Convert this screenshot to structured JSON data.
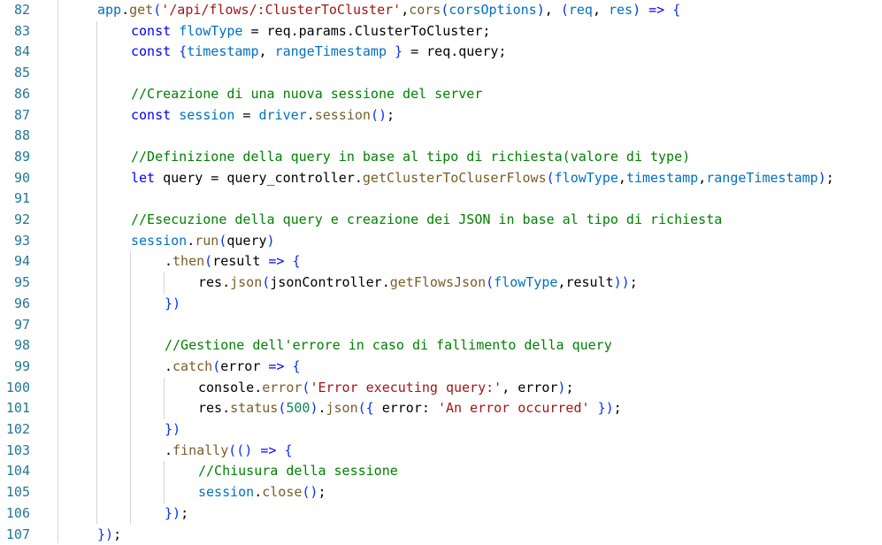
{
  "editor": {
    "colors": {
      "keyword": "#0000ff",
      "variable": "#0070c1",
      "function": "#795e26",
      "string": "#a31515",
      "comment": "#008000",
      "number": "#098658",
      "bracket": "#0431fa",
      "plain": "#000000",
      "line_number": "#237893"
    },
    "lines": [
      {
        "number": "82",
        "indent": 1,
        "tokens": [
          {
            "t": "app",
            "c": "var"
          },
          {
            "t": ".",
            "c": "plain"
          },
          {
            "t": "get",
            "c": "fn"
          },
          {
            "t": "(",
            "c": "brk"
          },
          {
            "t": "'/api/flows/:ClusterToCluster'",
            "c": "str"
          },
          {
            "t": ",",
            "c": "plain"
          },
          {
            "t": "cors",
            "c": "fn"
          },
          {
            "t": "(",
            "c": "brk"
          },
          {
            "t": "corsOptions",
            "c": "var"
          },
          {
            "t": ")",
            "c": "brk"
          },
          {
            "t": ", ",
            "c": "plain"
          },
          {
            "t": "(",
            "c": "brk"
          },
          {
            "t": "req",
            "c": "var"
          },
          {
            "t": ", ",
            "c": "plain"
          },
          {
            "t": "res",
            "c": "var"
          },
          {
            "t": ")",
            "c": "brk"
          },
          {
            "t": " ",
            "c": "plain"
          },
          {
            "t": "=>",
            "c": "key"
          },
          {
            "t": " ",
            "c": "plain"
          },
          {
            "t": "{",
            "c": "brk"
          }
        ]
      },
      {
        "number": "83",
        "indent": 2,
        "tokens": [
          {
            "t": "const",
            "c": "key"
          },
          {
            "t": " ",
            "c": "plain"
          },
          {
            "t": "flowType",
            "c": "var"
          },
          {
            "t": " = req.params.ClusterToCluster;",
            "c": "plain"
          }
        ]
      },
      {
        "number": "84",
        "indent": 2,
        "tokens": [
          {
            "t": "const",
            "c": "key"
          },
          {
            "t": " ",
            "c": "plain"
          },
          {
            "t": "{",
            "c": "brk"
          },
          {
            "t": "timestamp",
            "c": "var"
          },
          {
            "t": ", ",
            "c": "plain"
          },
          {
            "t": "rangeTimestamp",
            "c": "var"
          },
          {
            "t": " ",
            "c": "plain"
          },
          {
            "t": "}",
            "c": "brk"
          },
          {
            "t": " = req.query;",
            "c": "plain"
          }
        ]
      },
      {
        "number": "85",
        "indent": 0,
        "tokens": []
      },
      {
        "number": "86",
        "indent": 2,
        "tokens": [
          {
            "t": "//Creazione di una nuova sessione del server",
            "c": "com"
          }
        ]
      },
      {
        "number": "87",
        "indent": 2,
        "tokens": [
          {
            "t": "const",
            "c": "key"
          },
          {
            "t": " ",
            "c": "plain"
          },
          {
            "t": "session",
            "c": "var"
          },
          {
            "t": " = ",
            "c": "plain"
          },
          {
            "t": "driver",
            "c": "var"
          },
          {
            "t": ".",
            "c": "plain"
          },
          {
            "t": "session",
            "c": "fn"
          },
          {
            "t": "()",
            "c": "brk"
          },
          {
            "t": ";",
            "c": "plain"
          }
        ]
      },
      {
        "number": "88",
        "indent": 0,
        "tokens": []
      },
      {
        "number": "89",
        "indent": 2,
        "tokens": [
          {
            "t": "//Definizione della query in base al tipo di richiesta(valore di type)",
            "c": "com"
          }
        ]
      },
      {
        "number": "90",
        "indent": 2,
        "tokens": [
          {
            "t": "let",
            "c": "key"
          },
          {
            "t": " query = query_controller.",
            "c": "plain"
          },
          {
            "t": "getClusterToCluserFlows",
            "c": "fn"
          },
          {
            "t": "(",
            "c": "brk"
          },
          {
            "t": "flowType",
            "c": "var"
          },
          {
            "t": ",",
            "c": "plain"
          },
          {
            "t": "timestamp",
            "c": "var"
          },
          {
            "t": ",",
            "c": "plain"
          },
          {
            "t": "rangeTimestamp",
            "c": "var"
          },
          {
            "t": ")",
            "c": "brk"
          },
          {
            "t": ";",
            "c": "plain"
          }
        ]
      },
      {
        "number": "91",
        "indent": 0,
        "tokens": []
      },
      {
        "number": "92",
        "indent": 2,
        "tokens": [
          {
            "t": "//Esecuzione della query e creazione dei JSON in base al tipo di richiesta",
            "c": "com"
          }
        ]
      },
      {
        "number": "93",
        "indent": 2,
        "tokens": [
          {
            "t": "session",
            "c": "var"
          },
          {
            "t": ".",
            "c": "plain"
          },
          {
            "t": "run",
            "c": "fn"
          },
          {
            "t": "(",
            "c": "brk"
          },
          {
            "t": "query",
            "c": "plain"
          },
          {
            "t": ")",
            "c": "brk"
          }
        ]
      },
      {
        "number": "94",
        "indent": 3,
        "tokens": [
          {
            "t": ".",
            "c": "plain"
          },
          {
            "t": "then",
            "c": "fn"
          },
          {
            "t": "(",
            "c": "brk"
          },
          {
            "t": "result",
            "c": "plain"
          },
          {
            "t": " ",
            "c": "plain"
          },
          {
            "t": "=>",
            "c": "key"
          },
          {
            "t": " ",
            "c": "plain"
          },
          {
            "t": "{",
            "c": "brk"
          }
        ]
      },
      {
        "number": "95",
        "indent": 4,
        "tokens": [
          {
            "t": "res",
            "c": "plain"
          },
          {
            "t": ".",
            "c": "plain"
          },
          {
            "t": "json",
            "c": "fn"
          },
          {
            "t": "(",
            "c": "brk"
          },
          {
            "t": "jsonController",
            "c": "plain"
          },
          {
            "t": ".",
            "c": "plain"
          },
          {
            "t": "getFlowsJson",
            "c": "fn"
          },
          {
            "t": "(",
            "c": "brk"
          },
          {
            "t": "flowType",
            "c": "var"
          },
          {
            "t": ",",
            "c": "plain"
          },
          {
            "t": "result",
            "c": "plain"
          },
          {
            "t": "))",
            "c": "brk"
          },
          {
            "t": ";",
            "c": "plain"
          }
        ]
      },
      {
        "number": "96",
        "indent": 3,
        "tokens": [
          {
            "t": "})",
            "c": "brk"
          }
        ]
      },
      {
        "number": "97",
        "indent": 0,
        "tokens": []
      },
      {
        "number": "98",
        "indent": 3,
        "tokens": [
          {
            "t": "//Gestione dell'errore in caso di fallimento della query",
            "c": "com"
          }
        ]
      },
      {
        "number": "99",
        "indent": 3,
        "tokens": [
          {
            "t": ".",
            "c": "plain"
          },
          {
            "t": "catch",
            "c": "fn"
          },
          {
            "t": "(",
            "c": "brk"
          },
          {
            "t": "error",
            "c": "plain"
          },
          {
            "t": " ",
            "c": "plain"
          },
          {
            "t": "=>",
            "c": "key"
          },
          {
            "t": " ",
            "c": "plain"
          },
          {
            "t": "{",
            "c": "brk"
          }
        ]
      },
      {
        "number": "100",
        "indent": 4,
        "tokens": [
          {
            "t": "console",
            "c": "plain"
          },
          {
            "t": ".",
            "c": "plain"
          },
          {
            "t": "error",
            "c": "fn"
          },
          {
            "t": "(",
            "c": "brk"
          },
          {
            "t": "'Error executing query:'",
            "c": "str"
          },
          {
            "t": ", error",
            "c": "plain"
          },
          {
            "t": ")",
            "c": "brk"
          },
          {
            "t": ";",
            "c": "plain"
          }
        ]
      },
      {
        "number": "101",
        "indent": 4,
        "tokens": [
          {
            "t": "res",
            "c": "plain"
          },
          {
            "t": ".",
            "c": "plain"
          },
          {
            "t": "status",
            "c": "fn"
          },
          {
            "t": "(",
            "c": "brk"
          },
          {
            "t": "500",
            "c": "num"
          },
          {
            "t": ")",
            "c": "brk"
          },
          {
            "t": ".",
            "c": "plain"
          },
          {
            "t": "json",
            "c": "fn"
          },
          {
            "t": "(",
            "c": "brk"
          },
          {
            "t": "{",
            "c": "brk"
          },
          {
            "t": " error: ",
            "c": "plain"
          },
          {
            "t": "'An error occurred'",
            "c": "str"
          },
          {
            "t": " ",
            "c": "plain"
          },
          {
            "t": "})",
            "c": "brk"
          },
          {
            "t": ";",
            "c": "plain"
          }
        ]
      },
      {
        "number": "102",
        "indent": 3,
        "tokens": [
          {
            "t": "})",
            "c": "brk"
          }
        ]
      },
      {
        "number": "103",
        "indent": 3,
        "tokens": [
          {
            "t": ".",
            "c": "plain"
          },
          {
            "t": "finally",
            "c": "fn"
          },
          {
            "t": "(",
            "c": "brk"
          },
          {
            "t": "()",
            "c": "brk"
          },
          {
            "t": " ",
            "c": "plain"
          },
          {
            "t": "=>",
            "c": "key"
          },
          {
            "t": " ",
            "c": "plain"
          },
          {
            "t": "{",
            "c": "brk"
          }
        ]
      },
      {
        "number": "104",
        "indent": 4,
        "tokens": [
          {
            "t": "//Chiusura della sessione",
            "c": "com"
          }
        ]
      },
      {
        "number": "105",
        "indent": 4,
        "tokens": [
          {
            "t": "session",
            "c": "var"
          },
          {
            "t": ".",
            "c": "plain"
          },
          {
            "t": "close",
            "c": "fn"
          },
          {
            "t": "()",
            "c": "brk"
          },
          {
            "t": ";",
            "c": "plain"
          }
        ]
      },
      {
        "number": "106",
        "indent": 3,
        "tokens": [
          {
            "t": "})",
            "c": "brk"
          },
          {
            "t": ";",
            "c": "plain"
          }
        ]
      },
      {
        "number": "107",
        "indent": 1,
        "tokens": [
          {
            "t": "})",
            "c": "brk"
          },
          {
            "t": ";",
            "c": "plain"
          }
        ]
      }
    ]
  }
}
